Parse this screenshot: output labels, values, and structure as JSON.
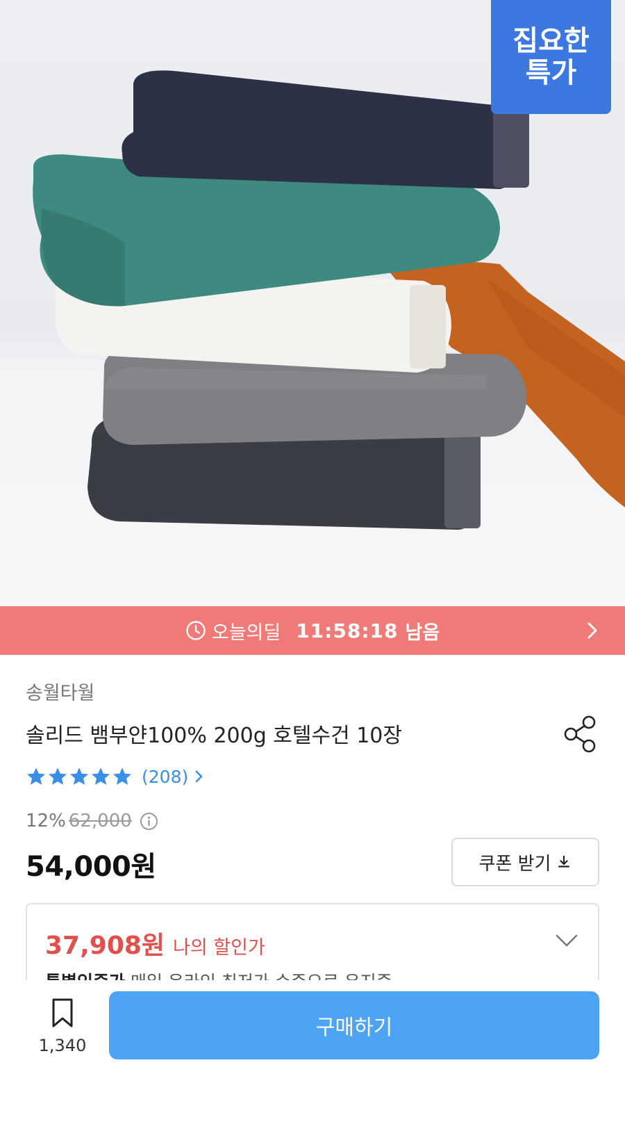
{
  "badge": {
    "line1": "집요한",
    "line2": "특가"
  },
  "deal_bar": {
    "label": "오늘의딜",
    "countdown": "11:58:18",
    "suffix": "남음",
    "background": "#f07a78"
  },
  "product": {
    "brand": "송월타월",
    "title": "솔리드 뱀부얀100% 200g 호텔수건 10장",
    "rating": {
      "stars": 5,
      "reviews": "(208)"
    },
    "discount_percent": "12%",
    "original_price": "62,000",
    "price": "54,000원",
    "coupon_label": "쿠폰 받기",
    "my_price": "37,908원",
    "my_price_label": "나의 할인가",
    "my_price_sub_bold": "특별인증가",
    "my_price_sub_rest": " 매일 온라인 최저가 수준으로 유지중"
  },
  "bottom_bar": {
    "bookmark_count": "1,340",
    "buy_label": "구매하기",
    "buy_color": "#4da3f4"
  },
  "icons": [
    "clock-icon",
    "chevron-right-icon",
    "share-icon",
    "star-icon",
    "info-icon",
    "download-icon",
    "chevron-down-icon",
    "bookmark-icon"
  ]
}
